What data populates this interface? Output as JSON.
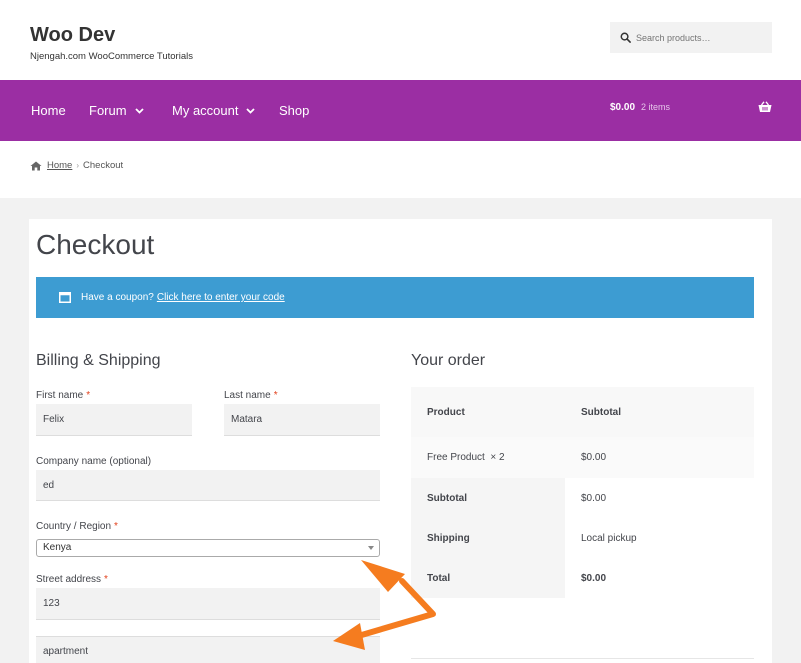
{
  "header": {
    "site_title": "Woo Dev",
    "site_description": "Njengah.com WooCommerce Tutorials",
    "search_placeholder": "Search products…"
  },
  "nav": {
    "items": [
      {
        "label": "Home",
        "has_dropdown": false
      },
      {
        "label": "Forum",
        "has_dropdown": true
      },
      {
        "label": "My account",
        "has_dropdown": true
      },
      {
        "label": "Shop",
        "has_dropdown": false
      }
    ],
    "cart_total": "$0.00",
    "cart_count": "2 items"
  },
  "breadcrumb": {
    "home": "Home",
    "current": "Checkout"
  },
  "page": {
    "title": "Checkout"
  },
  "coupon": {
    "text": "Have a coupon?",
    "link": "Click here to enter your code"
  },
  "billing": {
    "heading": "Billing & Shipping",
    "first_name_label": "First name",
    "first_name_value": "Felix",
    "last_name_label": "Last name",
    "last_name_value": "Matara",
    "company_label": "Company name (optional)",
    "company_value": "ed",
    "country_label": "Country / Region",
    "country_value": "Kenya",
    "street_label": "Street address",
    "street_value": "123",
    "street2_value": "apartment",
    "required_mark": "*"
  },
  "order": {
    "heading": "Your order",
    "col_product": "Product",
    "col_subtotal": "Subtotal",
    "item_name": "Free Product",
    "item_qty": "× 2",
    "item_price": "$0.00",
    "subtotal_label": "Subtotal",
    "subtotal_value": "$0.00",
    "shipping_label": "Shipping",
    "shipping_value": "Local pickup",
    "total_label": "Total",
    "total_value": "$0.00"
  },
  "colors": {
    "brand_purple": "#9b2ea3",
    "info_blue": "#3d9cd2",
    "annotation_orange": "#f57c1f",
    "required_red": "#e2401c"
  }
}
